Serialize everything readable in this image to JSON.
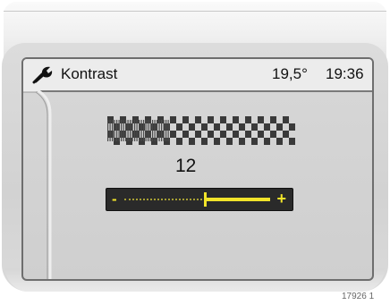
{
  "header": {
    "icon": "wrench-icon",
    "title": "Kontrast",
    "temperature": "19,5°",
    "time": "19:36"
  },
  "settings": {
    "value_label": "12",
    "slider": {
      "min_label": "-",
      "max_label": "+",
      "level": 0.55
    },
    "accent_color": "#f2e42a"
  },
  "figure_id": "17926 1"
}
